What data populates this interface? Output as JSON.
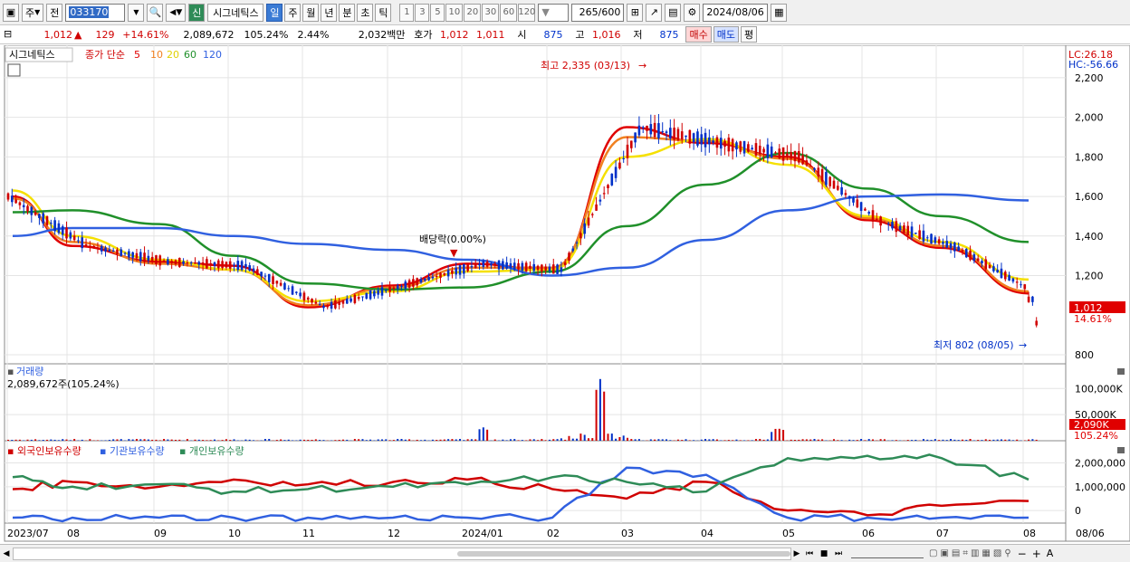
{
  "toolbar": {
    "market_label": "주",
    "compare_label": "전",
    "stock_code": "033170",
    "new_badge": "신",
    "stock_name": "시그네틱스",
    "periods": [
      "일",
      "주",
      "월",
      "년",
      "분",
      "초",
      "틱"
    ],
    "active_period": "일",
    "intervals": [
      "1",
      "3",
      "5",
      "10",
      "20",
      "30",
      "60",
      "120"
    ],
    "count": "265",
    "max_count": "/600",
    "date": "2024/08/06"
  },
  "info": {
    "price": "1,012",
    "change": "129",
    "change_pct": "+14.61%",
    "volume": "2,089,672",
    "volume_ratio": "105.24%",
    "turnover": "2.44%",
    "amount": "2,032백만",
    "quote_label": "호가",
    "ask": "1,012",
    "bid": "1,011",
    "open_label": "시",
    "open": "875",
    "high_label": "고",
    "high": "1,016",
    "low_label": "저",
    "low": "875",
    "buy_label": "매수",
    "sell_label": "매도",
    "avg_label": "평"
  },
  "price_panel": {
    "legend_name": "시그네틱스",
    "legend_ma": "종가 단순",
    "ma_periods": [
      "5",
      "10",
      "20",
      "60",
      "120"
    ],
    "lc": "LC:26.18",
    "hc": "HC:-56.66",
    "high_annot": "최고 2,335 (03/13)",
    "low_annot": "최저 802 (08/05)",
    "dividend_annot": "배당락(0.00%)",
    "current_price_tag": "1,012",
    "current_pct_tag": "14.61%",
    "y_ticks": [
      "2,200",
      "2,000",
      "1,800",
      "1,600",
      "1,400",
      "1,200",
      "800"
    ],
    "y_tick_values": [
      2200,
      2000,
      1800,
      1600,
      1400,
      1200,
      800
    ]
  },
  "volume_panel": {
    "title": "거래량",
    "value": "2,089,672주(105.24%)",
    "y_ticks": [
      "100,000K",
      "50,000K"
    ],
    "y_tick_values": [
      100000,
      50000
    ],
    "current_tag": "2,090K",
    "current_pct": "105.24%"
  },
  "holding_panel": {
    "series": [
      "외국인보유수량",
      "기관보유수량",
      "개인보유수량"
    ],
    "y_ticks": [
      "2,000,000",
      "1,000,000",
      "0"
    ],
    "y_tick_values": [
      2000000,
      1000000,
      0
    ]
  },
  "x_labels": [
    "2023/07",
    "08",
    "09",
    "10",
    "11",
    "12",
    "2024/01",
    "02",
    "03",
    "04",
    "05",
    "06",
    "07",
    "08",
    "08/06"
  ],
  "colors": {
    "up": "#d00000",
    "down": "#0030c8",
    "ma5": "#e00000",
    "ma10": "#f08020",
    "ma20": "#f5e000",
    "ma60": "#20902a",
    "ma120": "#3060e0",
    "foreign": "#d00000",
    "inst": "#3060e0",
    "retail": "#2e8b57"
  },
  "chart_data": {
    "type": "line",
    "x": [
      "2023/07",
      "08",
      "09",
      "10",
      "11",
      "12",
      "2024/01",
      "02",
      "03",
      "04",
      "05",
      "06",
      "07",
      "08"
    ],
    "series": [
      {
        "name": "5",
        "values": [
          1600,
          1350,
          1270,
          1250,
          1040,
          1150,
          1260,
          1230,
          1950,
          1870,
          1800,
          1480,
          1340,
          1110
        ]
      },
      {
        "name": "10",
        "values": [
          1590,
          1370,
          1260,
          1230,
          1050,
          1140,
          1240,
          1240,
          1900,
          1880,
          1790,
          1490,
          1350,
          1120
        ]
      },
      {
        "name": "20",
        "values": [
          1630,
          1400,
          1280,
          1230,
          1070,
          1120,
          1220,
          1230,
          1800,
          1890,
          1760,
          1500,
          1370,
          1180
        ]
      },
      {
        "name": "60",
        "values": [
          1520,
          1530,
          1460,
          1300,
          1160,
          1130,
          1140,
          1220,
          1450,
          1660,
          1820,
          1640,
          1500,
          1370
        ]
      },
      {
        "name": "120",
        "values": [
          1400,
          1440,
          1440,
          1400,
          1360,
          1330,
          1280,
          1200,
          1240,
          1380,
          1530,
          1600,
          1610,
          1580
        ]
      }
    ],
    "ylim": [
      800,
      2300
    ]
  }
}
